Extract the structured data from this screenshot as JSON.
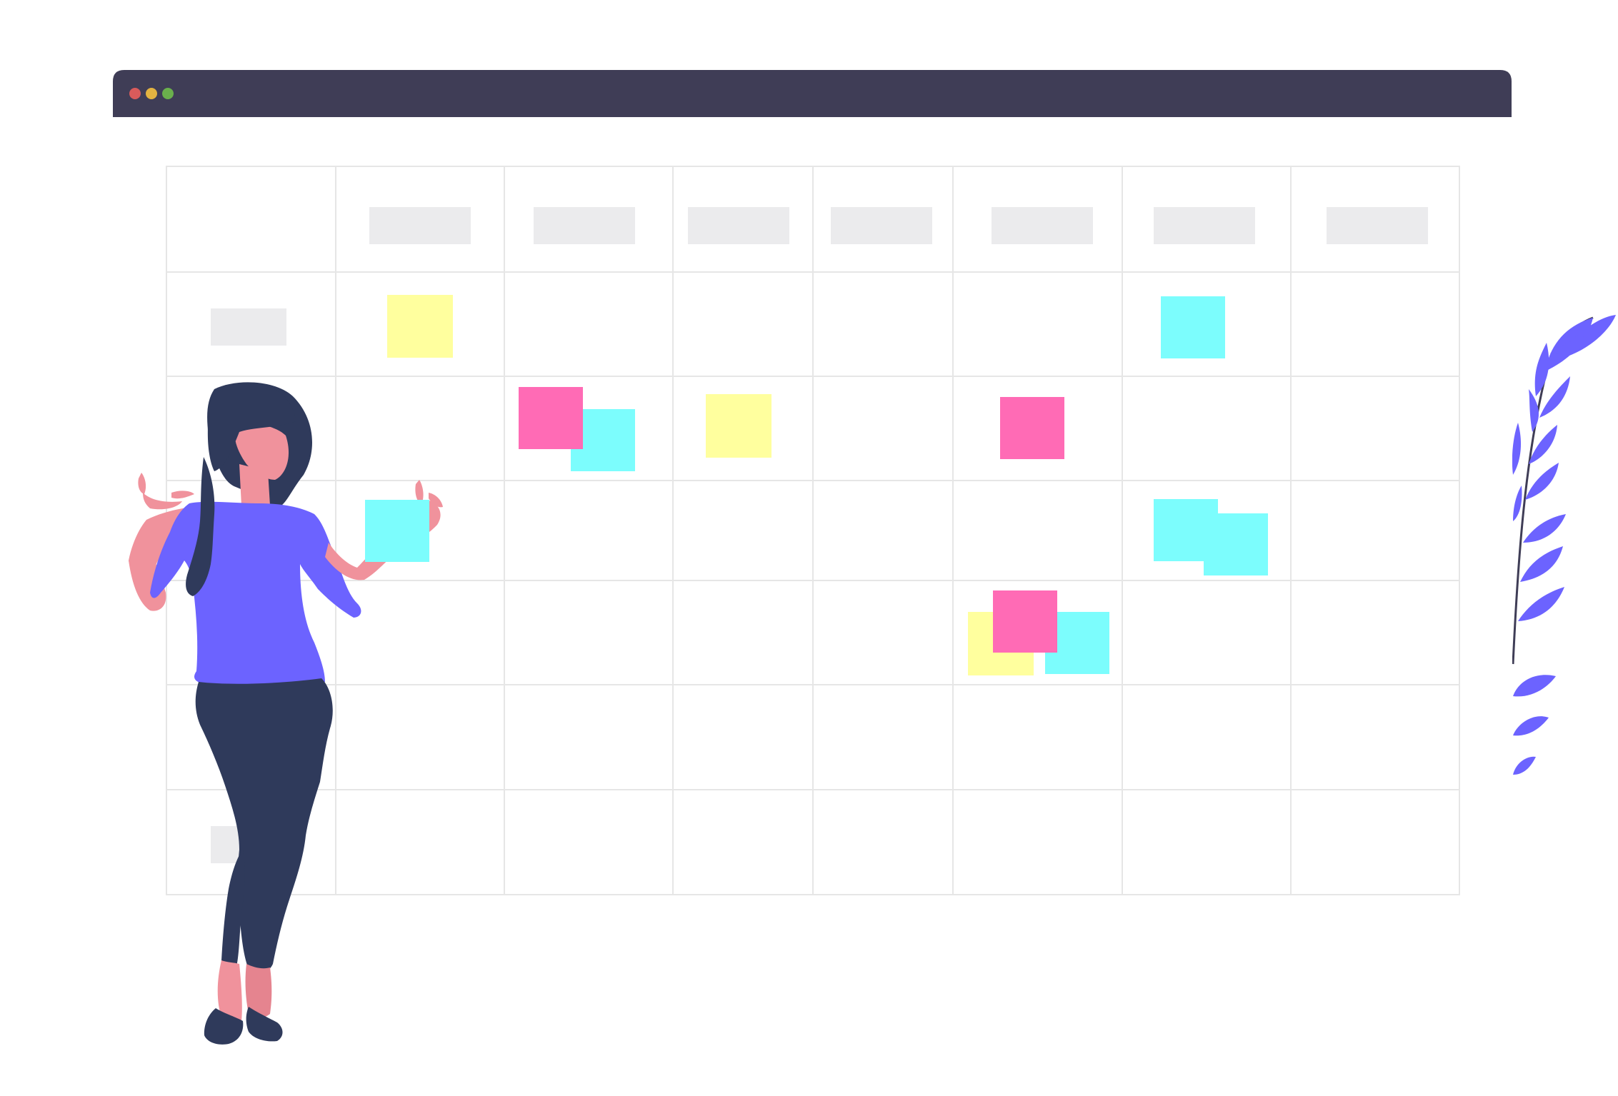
{
  "window": {
    "controls": [
      {
        "name": "close-dot",
        "color": "#d95b5b"
      },
      {
        "name": "minimize-dot",
        "color": "#e3b341"
      },
      {
        "name": "maximize-dot",
        "color": "#6ab04c"
      }
    ],
    "titlebar_color": "#3f3d56"
  },
  "calendar": {
    "columns": 8,
    "rows": 7,
    "header_placeholder_color": "#ebebed",
    "grid_line_color": "#e6e6e6",
    "row_label_placeholders": [
      "row-1-label",
      "row-6-label"
    ]
  },
  "sticky_note_colors": {
    "yellow": "#ffff9e",
    "cyan": "#7cfdfd",
    "pink": "#ff6bb5"
  },
  "sticky_notes": [
    {
      "row": 1,
      "col": 1,
      "color": "yellow"
    },
    {
      "row": 1,
      "col": 6,
      "color": "cyan"
    },
    {
      "row": 2,
      "col": 2,
      "color": "cyan"
    },
    {
      "row": 2,
      "col": 2,
      "color": "pink"
    },
    {
      "row": 2,
      "col": 3,
      "color": "yellow"
    },
    {
      "row": 2,
      "col": 5,
      "color": "pink"
    },
    {
      "row": 3,
      "col": 1,
      "color": "cyan"
    },
    {
      "row": 3,
      "col": 6,
      "color": "cyan"
    },
    {
      "row": 3,
      "col": 6,
      "color": "cyan"
    },
    {
      "row": 4,
      "col": 5,
      "color": "yellow"
    },
    {
      "row": 4,
      "col": 5,
      "color": "cyan"
    },
    {
      "row": 4,
      "col": 5,
      "color": "pink"
    }
  ],
  "illustration": {
    "person": "woman-placing-sticky-note",
    "plant": "leafy-branch",
    "accent_color": "#6c63ff",
    "skin_color": "#f0929c",
    "hair_color": "#2f3a5b"
  }
}
